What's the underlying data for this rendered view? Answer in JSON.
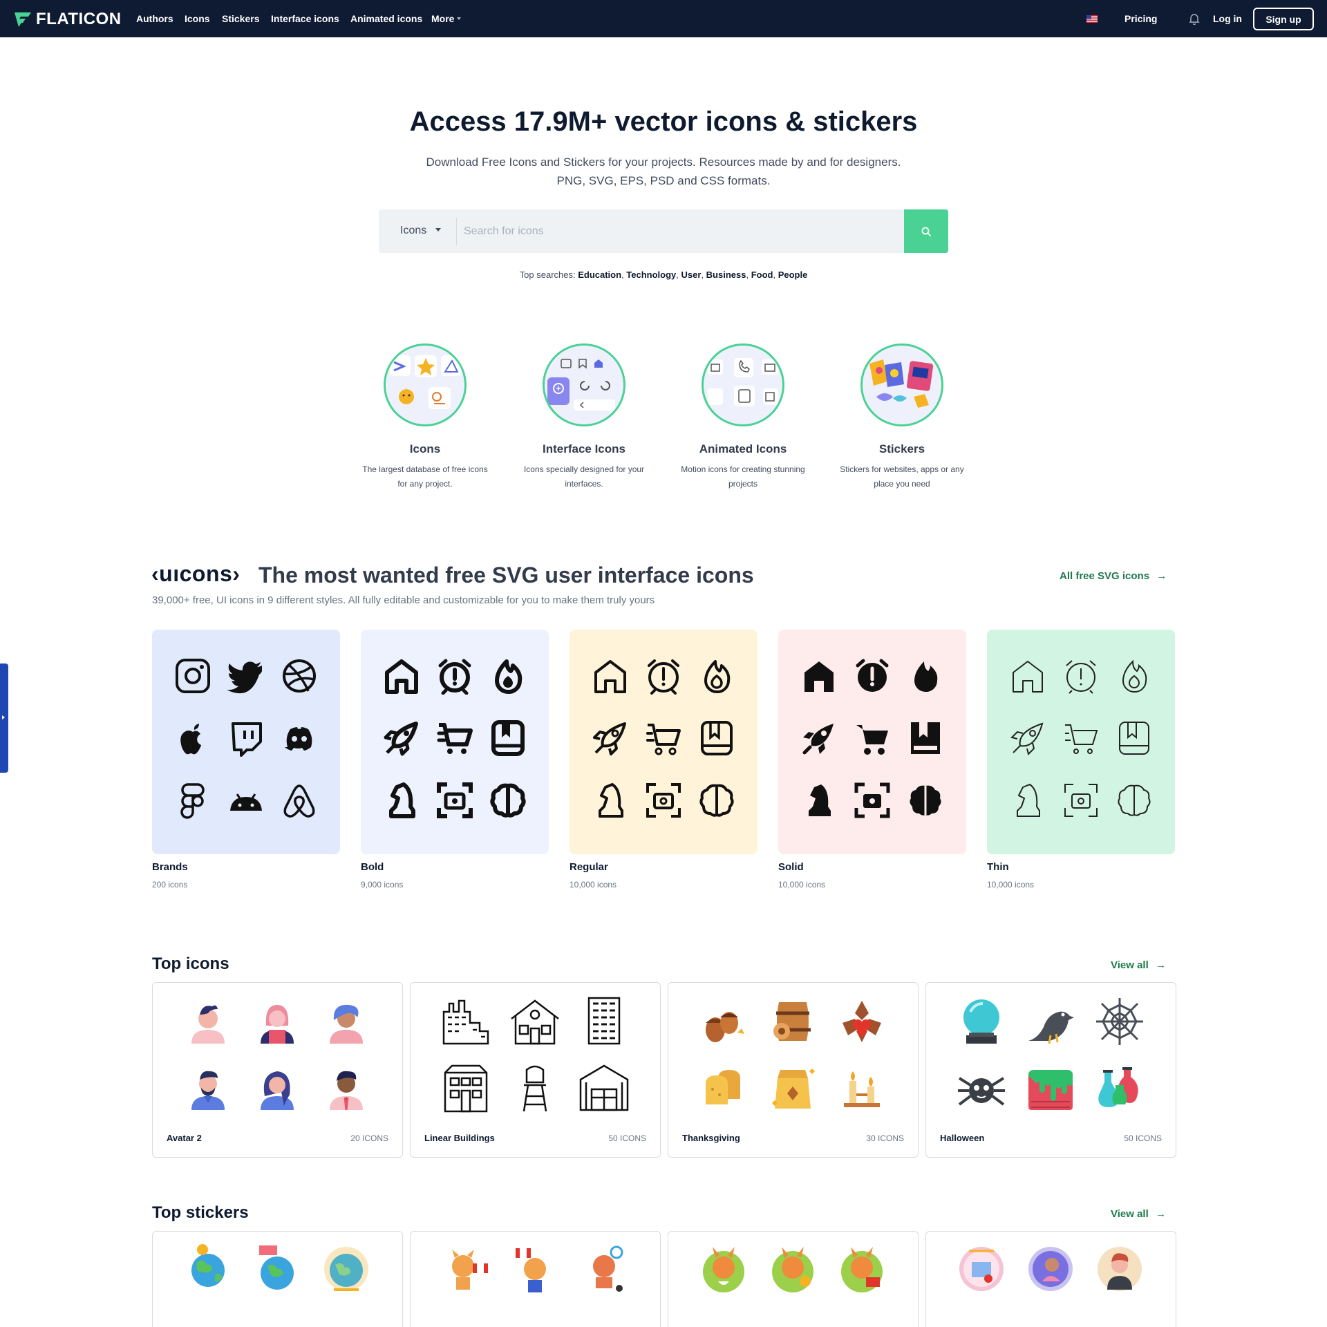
{
  "nav": {
    "brand": "FLATICON",
    "links": [
      "Authors",
      "Icons",
      "Stickers",
      "Interface icons",
      "Animated icons",
      "More"
    ],
    "pricing": "Pricing",
    "login": "Log in",
    "signup": "Sign up"
  },
  "hero": {
    "title": "Access 17.9M+ vector icons & stickers",
    "sub1": "Download Free Icons and Stickers for your projects. Resources made by and for designers.",
    "sub2": "PNG, SVG, EPS, PSD and CSS formats.",
    "search_type": "Icons",
    "search_placeholder": "Search for icons",
    "top_searches_label": "Top searches:",
    "top_searches": [
      "Education",
      "Technology",
      "User",
      "Business",
      "Food",
      "People"
    ]
  },
  "categories": [
    {
      "title": "Icons",
      "desc1": "The largest database of free icons",
      "desc2": "for any project."
    },
    {
      "title": "Interface Icons",
      "desc1": "Icons specially designed for your",
      "desc2": "interfaces."
    },
    {
      "title": "Animated Icons",
      "desc1": "Motion icons for creating stunning",
      "desc2": "projects"
    },
    {
      "title": "Stickers",
      "desc1": "Stickers for websites, apps or any",
      "desc2": "place you need"
    }
  ],
  "uicons": {
    "brand": "‹uıcons›",
    "title": "The most wanted free SVG user interface icons",
    "sub": "39,000+ free, UI icons in 9 different styles. All fully editable and customizable for you to make them truly yours",
    "all_link": "All free SVG icons",
    "styles": [
      {
        "name": "Brands",
        "count": "200 icons",
        "bg": "#e1eafc"
      },
      {
        "name": "Bold",
        "count": "9,000 icons",
        "bg": "#eef2fe"
      },
      {
        "name": "Regular",
        "count": "10,000 icons",
        "bg": "#fff3d9"
      },
      {
        "name": "Solid",
        "count": "10,000 icons",
        "bg": "#fdeceb"
      },
      {
        "name": "Thin",
        "count": "10,000 icons",
        "bg": "#d2f4e2"
      }
    ]
  },
  "top_icons": {
    "title": "Top icons",
    "view_all": "View all",
    "packs": [
      {
        "name": "Avatar 2",
        "count": "20 ICONS"
      },
      {
        "name": "Linear Buildings",
        "count": "50 ICONS"
      },
      {
        "name": "Thanksgiving",
        "count": "30 ICONS"
      },
      {
        "name": "Halloween",
        "count": "50 ICONS"
      }
    ]
  },
  "top_stickers": {
    "title": "Top stickers",
    "view_all": "View all"
  },
  "colors": {
    "nav_bg": "#0f1a33",
    "accent_green": "#4ad295",
    "link_green": "#1d7a4a",
    "text_dark": "#0e1a2f"
  }
}
